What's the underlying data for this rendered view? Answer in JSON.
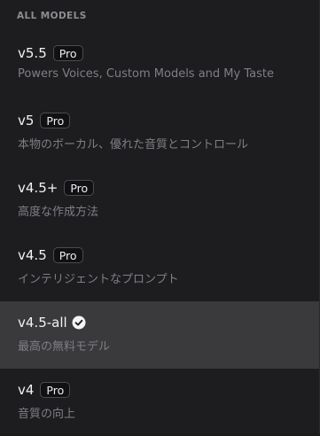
{
  "section_header": "ALL MODELS",
  "models": [
    {
      "name": "v5.5",
      "badge": "Pro",
      "description": "Powers Voices, Custom Models and My Taste",
      "selected": false
    },
    {
      "name": "v5",
      "badge": "Pro",
      "description": "本物のボーカル、優れた音質とコントロール",
      "selected": false
    },
    {
      "name": "v4.5+",
      "badge": "Pro",
      "description": "高度な作成方法",
      "selected": false
    },
    {
      "name": "v4.5",
      "badge": "Pro",
      "description": "インテリジェントなプロンプト",
      "selected": false
    },
    {
      "name": "v4.5-all",
      "badge": "",
      "description": "最高の無料モデル",
      "selected": true,
      "icon": "check-circle-icon"
    },
    {
      "name": "v4",
      "badge": "Pro",
      "description": "音質の向上",
      "selected": false
    }
  ],
  "colors": {
    "background": "#1d1d20",
    "selected_background": "#3a3a3d",
    "title_text": "#f2f2f4",
    "description_text": "#7e7e85",
    "header_text": "#8c8c92"
  }
}
